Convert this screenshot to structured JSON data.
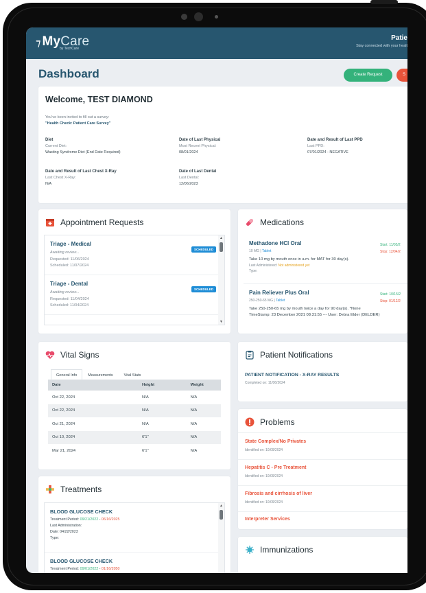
{
  "app": {
    "name_a": "My",
    "name_b": "Care",
    "sub": "by TechCare"
  },
  "topright": {
    "title": "Patie",
    "sub": "Stay connected with your healt"
  },
  "page_title": "Dashboard",
  "buttons": {
    "create": "Create Request",
    "red": "S"
  },
  "welcome": {
    "title": "Welcome, TEST DIAMOND",
    "invite": "You've been invited to fill out a survey:",
    "survey": "\"Health Check: Patient Care Survey\"",
    "fields": [
      {
        "h": "Diet",
        "s": "Current Diet:",
        "v": "Wasting Syndrome Diet (End Date Required)"
      },
      {
        "h": "Date of Last Physical",
        "s": "Most Recent Physical:",
        "v": "08/01/2024"
      },
      {
        "h": "Date and Result of Last PPD",
        "s": "Last PPD:",
        "v": "07/01/2024 - NEGATIVE"
      },
      {
        "h": "Date and Result of Last Chest X-Ray",
        "s": "Last Chest X-Ray:",
        "v": "N/A"
      },
      {
        "h": "Date of Last Dental",
        "s": "Last Dental:",
        "v": "12/06/2023"
      }
    ]
  },
  "appointments": {
    "title": "Appointment Requests",
    "items": [
      {
        "name": "Triage - Medical",
        "status": "Awaiting review...",
        "requested": "Requested: 11/06/2024",
        "scheduled": "Scheduled: 11/07/2024",
        "badge": "SCHEDULED"
      },
      {
        "name": "Triage - Dental",
        "status": "Awaiting review...",
        "requested": "Requested: 11/04/2024",
        "scheduled": "Scheduled: 11/04/2024",
        "badge": "SCHEDULED"
      }
    ]
  },
  "medications": {
    "title": "Medications",
    "items": [
      {
        "name": "Methadone HCl Oral",
        "dose": "10 MG",
        "form": "Tablet",
        "start": "Start: 11/05/2",
        "stop": "Stop: 12/04/2",
        "ins": "Take 10 mg by mouth once in a.m. for MAT for 30 day(s).",
        "admin_label": "Last Administered: ",
        "admin_val": "Not administered yet",
        "type": "Type:"
      },
      {
        "name": "Pain Reliever Plus Oral",
        "dose": "250-250-65 MG",
        "form": "Tablet",
        "start": "Start: 10/15/2",
        "stop": "Stop: 01/12/2",
        "ins": "Take 250-250-65 mg by mouth twice a day for 90 day(s). *None",
        "ins2": "TimeStamp: 23 December 2021 08:31:55 --- User: Debra Elder (DELDER)"
      }
    ]
  },
  "vitals": {
    "title": "Vital Signs",
    "tabs": [
      "General Info",
      "Measurements",
      "Vital Stats"
    ],
    "columns": [
      "Date",
      "Height",
      "Weight"
    ],
    "rows": [
      [
        "Oct 22, 2024",
        "N/A",
        "N/A"
      ],
      [
        "Oct 22, 2024",
        "N/A",
        "N/A"
      ],
      [
        "Oct 21, 2024",
        "N/A",
        "N/A"
      ],
      [
        "Oct 10, 2024",
        "6'1\"",
        "N/A"
      ],
      [
        "Mar 21, 2024",
        "6'1\"",
        "N/A"
      ]
    ]
  },
  "notifications": {
    "title": "Patient Notifications",
    "item": "PATIENT NOTIFICATION - X-RAY RESULTS",
    "date": "Completed on: 11/06/2024"
  },
  "problems": {
    "title": "Problems",
    "items": [
      {
        "name": "State Complex/No Privates",
        "date": "Identified on: 10/09/2024"
      },
      {
        "name": "Hepatitis C - Pre Treatment",
        "date": "Identified on: 10/09/2024"
      },
      {
        "name": "Fibrosis and cirrhosis of liver",
        "date": "Identified on: 10/09/2024"
      },
      {
        "name": "Interpreter Services",
        "date": ""
      }
    ]
  },
  "treatments": {
    "title": "Treatments",
    "items": [
      {
        "name": "BLOOD GLUCOSE CHECK",
        "period_label": "Treatment Period: ",
        "start": "09/21/2022",
        "end": "06/16/2025",
        "last_admin": "Last Administration:",
        "date": "Date: 04/22/2023",
        "type": "Type:"
      },
      {
        "name": "BLOOD GLUCOSE CHECK",
        "period_label": "Treatment Period: ",
        "start": "09/01/2022",
        "end": "01/16/2050"
      }
    ]
  },
  "immunizations": {
    "title": "Immunizations"
  },
  "colors": {
    "header": "#27566f",
    "accent_green": "#34b27b",
    "accent_red": "#e8533a",
    "link_blue": "#1f8dd6"
  }
}
